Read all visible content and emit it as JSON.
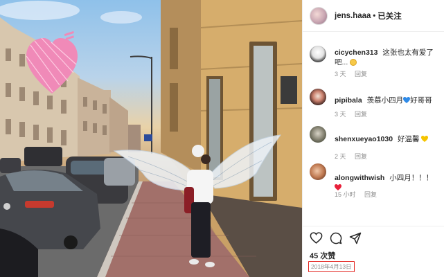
{
  "post": {
    "username": "jens.haaa",
    "follow_status": "已关注",
    "separator": "•"
  },
  "comments": [
    {
      "user": "cicychen313",
      "text": "这张也太有爱了吧...",
      "emoji": "laughing-face",
      "time": "3 天",
      "reply": "回复"
    },
    {
      "user": "pipibala",
      "text_before": "羡慕小四月",
      "emoji": "blue-heart",
      "text_after": "好哥哥",
      "time": "3 天",
      "reply": "回复"
    },
    {
      "user": "shenxueyao1030",
      "text": "好温馨",
      "emoji": "yellow-heart",
      "time": "2 天",
      "reply": "回复"
    },
    {
      "user": "alongwithwish",
      "text": "小四月！！！",
      "emoji": "red-heart",
      "time": "15 小时",
      "reply": "回复"
    }
  ],
  "actions": {
    "icons": [
      "heart-icon",
      "comment-icon",
      "share-icon"
    ],
    "likes": "45 次赞",
    "date": "2018年4月13日"
  },
  "colors": {
    "date_highlight_border": "#e3221d",
    "meta_text": "#8e8e8e",
    "text": "#262626",
    "blue_heart": "#2f8be8",
    "yellow_heart": "#f5c400",
    "red_heart": "#e8203a"
  }
}
